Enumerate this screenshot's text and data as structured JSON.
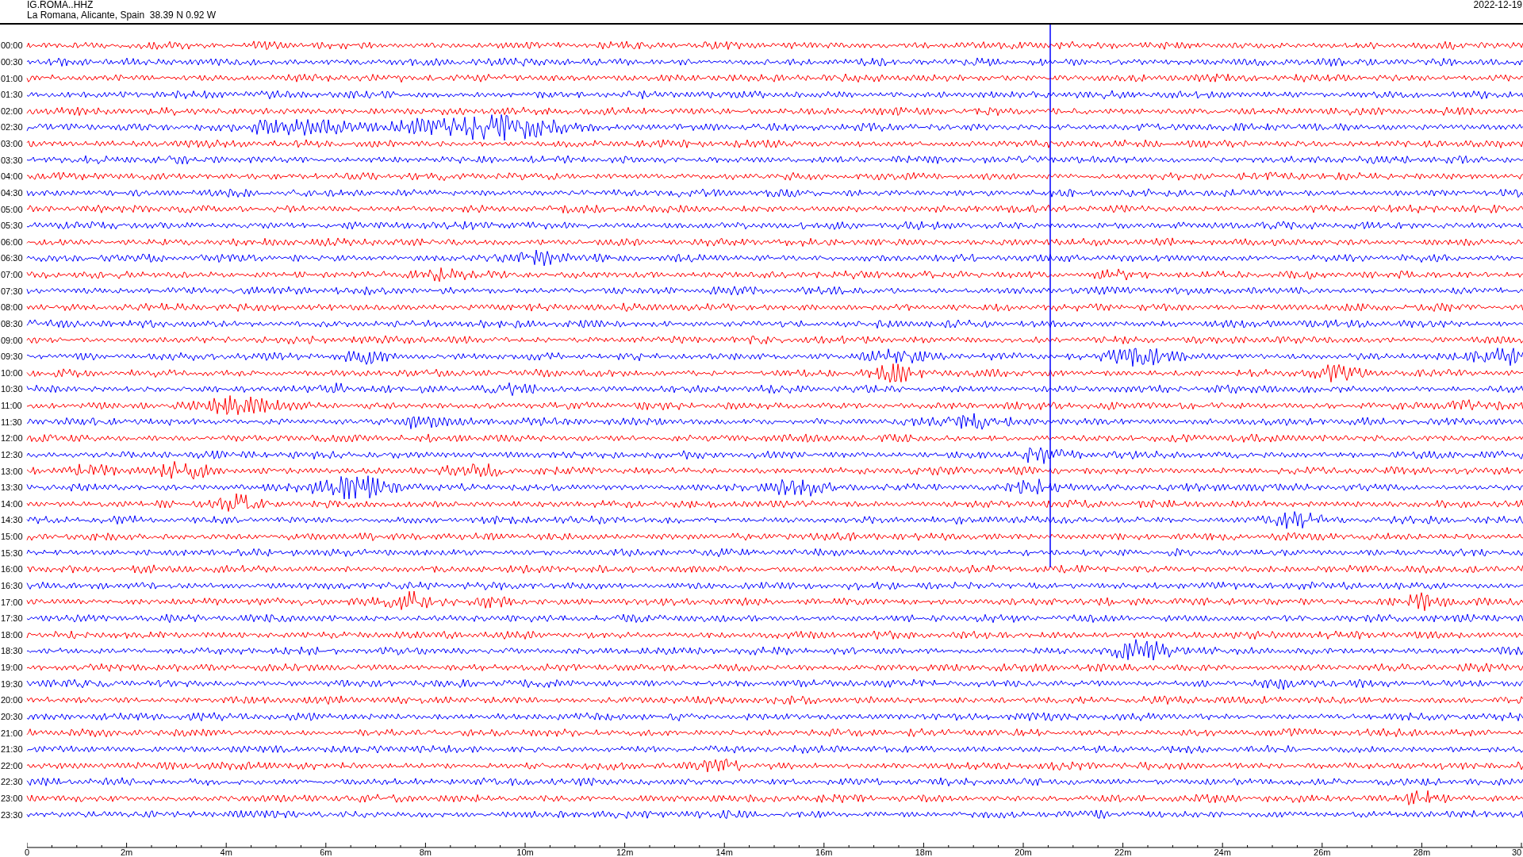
{
  "header": {
    "station": "IG.ROMA..HHZ",
    "location": "La Romana, Alicante, Spain  38.39 N 0.92 W",
    "date": "2022-12-19"
  },
  "rows": [
    {
      "time": "00:00",
      "color": "#ff0000"
    },
    {
      "time": "00:30",
      "color": "#0000ff"
    },
    {
      "time": "01:00",
      "color": "#ff0000"
    },
    {
      "time": "01:30",
      "color": "#0000ff"
    },
    {
      "time": "02:00",
      "color": "#ff0000"
    },
    {
      "time": "02:30",
      "color": "#0000ff"
    },
    {
      "time": "03:00",
      "color": "#ff0000"
    },
    {
      "time": "03:30",
      "color": "#0000ff"
    },
    {
      "time": "04:00",
      "color": "#ff0000"
    },
    {
      "time": "04:30",
      "color": "#0000ff"
    },
    {
      "time": "05:00",
      "color": "#ff0000"
    },
    {
      "time": "05:30",
      "color": "#0000ff"
    },
    {
      "time": "06:00",
      "color": "#ff0000"
    },
    {
      "time": "06:30",
      "color": "#0000ff"
    },
    {
      "time": "07:00",
      "color": "#ff0000"
    },
    {
      "time": "07:30",
      "color": "#0000ff"
    },
    {
      "time": "08:00",
      "color": "#ff0000"
    },
    {
      "time": "08:30",
      "color": "#0000ff"
    },
    {
      "time": "09:00",
      "color": "#ff0000"
    },
    {
      "time": "09:30",
      "color": "#0000ff"
    },
    {
      "time": "10:00",
      "color": "#ff0000"
    },
    {
      "time": "10:30",
      "color": "#0000ff"
    },
    {
      "time": "11:00",
      "color": "#ff0000"
    },
    {
      "time": "11:30",
      "color": "#0000ff"
    },
    {
      "time": "12:00",
      "color": "#ff0000"
    },
    {
      "time": "12:30",
      "color": "#0000ff"
    },
    {
      "time": "13:00",
      "color": "#ff0000"
    },
    {
      "time": "13:30",
      "color": "#0000ff"
    },
    {
      "time": "14:00",
      "color": "#ff0000"
    },
    {
      "time": "14:30",
      "color": "#0000ff"
    },
    {
      "time": "15:00",
      "color": "#ff0000"
    },
    {
      "time": "15:30",
      "color": "#0000ff"
    },
    {
      "time": "16:00",
      "color": "#ff0000"
    },
    {
      "time": "16:30",
      "color": "#0000ff"
    },
    {
      "time": "17:00",
      "color": "#ff0000"
    },
    {
      "time": "17:30",
      "color": "#0000ff"
    },
    {
      "time": "18:00",
      "color": "#ff0000"
    },
    {
      "time": "18:30",
      "color": "#0000ff"
    },
    {
      "time": "19:00",
      "color": "#ff0000"
    },
    {
      "time": "19:30",
      "color": "#0000ff"
    },
    {
      "time": "20:00",
      "color": "#ff0000"
    },
    {
      "time": "20:30",
      "color": "#0000ff"
    },
    {
      "time": "21:00",
      "color": "#ff0000"
    },
    {
      "time": "21:30",
      "color": "#0000ff"
    },
    {
      "time": "22:00",
      "color": "#ff0000"
    },
    {
      "time": "22:30",
      "color": "#0000ff"
    },
    {
      "time": "23:00",
      "color": "#ff0000"
    },
    {
      "time": "23:30",
      "color": "#0000ff"
    }
  ],
  "x_axis": {
    "ticks": [
      "0",
      "2m",
      "4m",
      "6m",
      "8m",
      "10m",
      "12m",
      "14m",
      "16m",
      "18m",
      "20m",
      "22m",
      "24m",
      "26m",
      "28m",
      "30"
    ]
  }
}
